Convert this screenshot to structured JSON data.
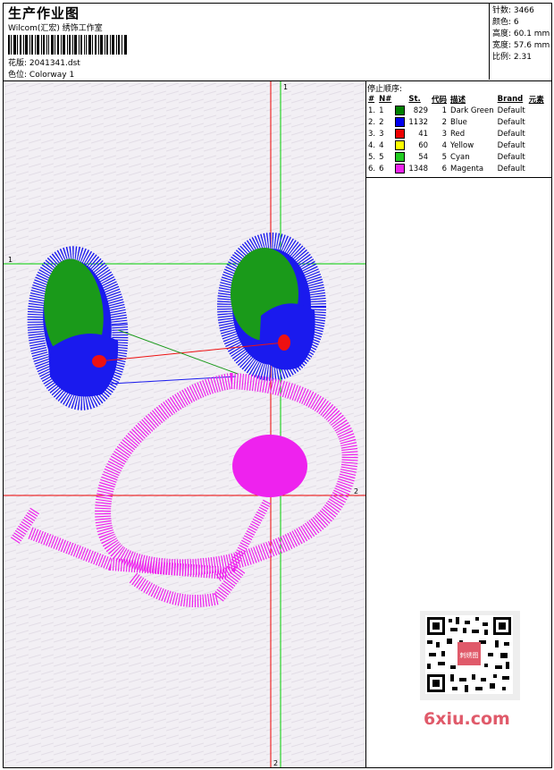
{
  "header": {
    "title": "生产作业图",
    "company": "Wilcom(汇宏) 绣饰工作室",
    "file_label": "花版:",
    "file_value": "2041341.dst",
    "colorway_label": "色位:",
    "colorway_value": "Colorway 1"
  },
  "stats": {
    "stitches": "针数: 3466",
    "colors": "颜色: 6",
    "height": "高度: 60.1 mm",
    "width": "宽度: 57.6 mm",
    "ratio": "比例: 2.31"
  },
  "stop_sequence": {
    "title": "停止顺序:",
    "headers": [
      "#",
      "N#",
      "St.",
      "代码",
      "描述",
      "Brand",
      "元素"
    ],
    "rows": [
      {
        "idx": "1.",
        "n": "1",
        "color": "#008000",
        "st": "829",
        "code": "1",
        "desc": "Dark Green",
        "brand": "Default"
      },
      {
        "idx": "2.",
        "n": "2",
        "color": "#0000ee",
        "st": "1132",
        "code": "2",
        "desc": "Blue",
        "brand": "Default"
      },
      {
        "idx": "3.",
        "n": "3",
        "color": "#ee0000",
        "st": "41",
        "code": "3",
        "desc": "Red",
        "brand": "Default"
      },
      {
        "idx": "4.",
        "n": "4",
        "color": "#ffff00",
        "st": "60",
        "code": "4",
        "desc": "Yellow",
        "brand": "Default"
      },
      {
        "idx": "5.",
        "n": "5",
        "color": "#22cc22",
        "st": "54",
        "code": "5",
        "desc": "Cyan",
        "brand": "Default"
      },
      {
        "idx": "6.",
        "n": "6",
        "color": "#ee22ee",
        "st": "1348",
        "code": "6",
        "desc": "Magenta",
        "brand": "Default"
      }
    ]
  },
  "guides": {
    "green_top": "1",
    "green_left": "1",
    "red_right": "2",
    "red_bottom": "2"
  },
  "watermark": {
    "text": "6xiu.com",
    "stamp": "刺绣图"
  },
  "colors": {
    "green": "#1a9a1a",
    "blue": "#1a1aee",
    "red": "#ee1111",
    "magenta": "#ee22ee",
    "guide_green": "#00cc00",
    "guide_red": "#ee0000"
  }
}
